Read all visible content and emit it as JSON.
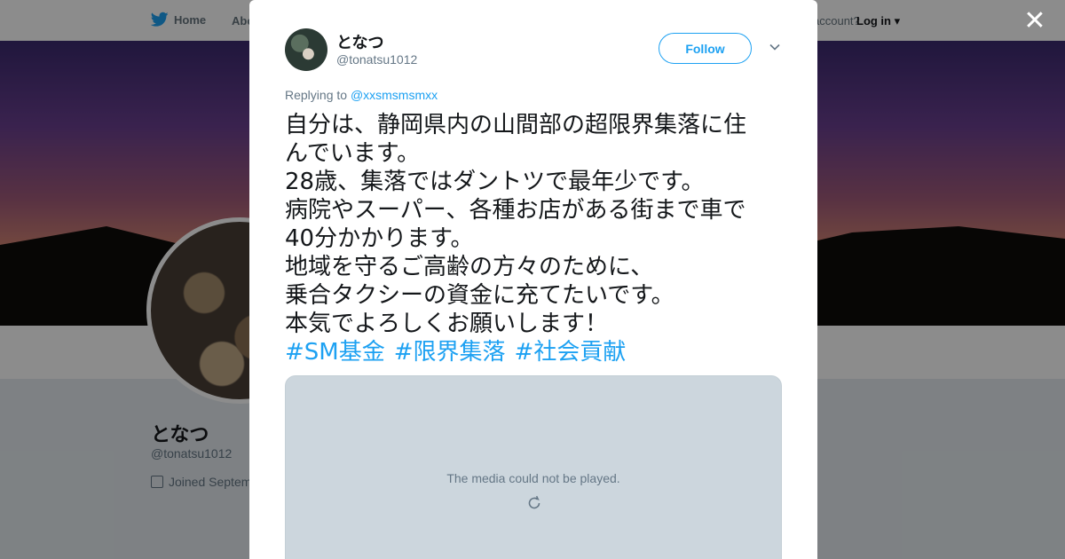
{
  "background": {
    "nav": {
      "home_label": "Home",
      "about_label": "Abo",
      "account_text": "account?",
      "login_label": "Log in"
    },
    "profile": {
      "name": "となつ",
      "handle": "@tonatsu1012",
      "joined": "Joined Septem"
    }
  },
  "modal": {
    "author_name": "となつ",
    "author_handle": "@tonatsu1012",
    "follow_label": "Follow",
    "replying_prefix": "Replying to",
    "replying_mention": "@xxsmsmsmxx",
    "tweet_lines": [
      "自分は、静岡県内の山間部の超限界集落に住",
      "んでいます。",
      "28歳、集落ではダントツで最年少です。",
      "病院やスーパー、各種お店がある街まで車で",
      "40分かかります。",
      "地域を守るご高齢の方々のために、",
      "乗合タクシーの資金に充てたいです。",
      "本気でよろしくお願いします！"
    ],
    "hashtags": [
      "#SM基金",
      "#限界集落",
      "#社会貢献"
    ],
    "media_message": "The media could not be played."
  },
  "colors": {
    "accent": "#1da1f2",
    "text": "#14171a",
    "secondary_text": "#657786",
    "media_bg": "#ccd6dd"
  },
  "icons": {
    "nav": "twitter-bird-icon",
    "close": "close-icon",
    "menu": "chevron-down-icon",
    "media": "retry-icon",
    "joined": "calendar-icon"
  }
}
